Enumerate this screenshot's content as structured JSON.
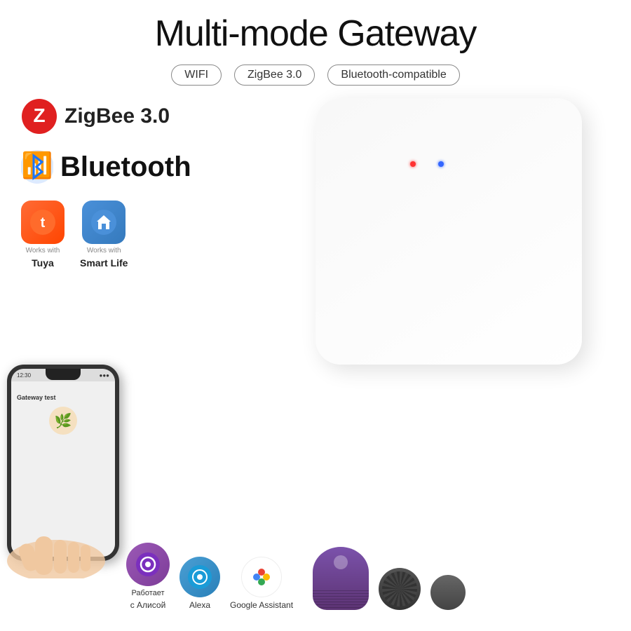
{
  "title": "Multi-mode Gateway",
  "badges": [
    "WIFI",
    "ZigBee 3.0",
    "Bluetooth-compatible"
  ],
  "features": {
    "zigbee_label": "ZigBee 3.0",
    "bluetooth_label": "Bluetooth"
  },
  "apps": [
    {
      "id": "tuya",
      "works_with": "Works with",
      "label": "Tuya"
    },
    {
      "id": "smartlife",
      "works_with": "Works with",
      "label": "Smart Life"
    }
  ],
  "phone": {
    "app_title": "Gateway test",
    "status_left": "12:30",
    "status_right": "●●●"
  },
  "assistants": [
    {
      "id": "alice",
      "sublabel": "Работает",
      "label": "с Алисой"
    },
    {
      "id": "alexa",
      "label": "Alexa"
    },
    {
      "id": "google",
      "label": "Google Assistant"
    }
  ],
  "led_colors": {
    "red": "#ff3333",
    "blue": "#3366ff"
  }
}
